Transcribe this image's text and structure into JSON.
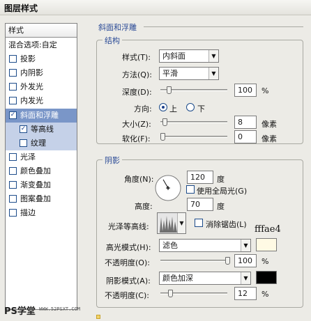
{
  "window": {
    "title": "图层样式"
  },
  "style_list": {
    "header": "样式",
    "items": [
      {
        "label": "混合选项:自定",
        "checkbox": false,
        "checked": false,
        "state": "normal",
        "indent": false
      },
      {
        "label": "投影",
        "checkbox": true,
        "checked": false,
        "state": "normal",
        "indent": false
      },
      {
        "label": "内阴影",
        "checkbox": true,
        "checked": false,
        "state": "normal",
        "indent": false
      },
      {
        "label": "外发光",
        "checkbox": true,
        "checked": false,
        "state": "normal",
        "indent": false
      },
      {
        "label": "内发光",
        "checkbox": true,
        "checked": false,
        "state": "normal",
        "indent": false
      },
      {
        "label": "斜面和浮雕",
        "checkbox": true,
        "checked": true,
        "state": "selected",
        "indent": false
      },
      {
        "label": "等高线",
        "checkbox": true,
        "checked": true,
        "state": "sub",
        "indent": true
      },
      {
        "label": "纹理",
        "checkbox": true,
        "checked": false,
        "state": "sub",
        "indent": true
      },
      {
        "label": "光泽",
        "checkbox": true,
        "checked": false,
        "state": "normal",
        "indent": false
      },
      {
        "label": "颜色叠加",
        "checkbox": true,
        "checked": false,
        "state": "normal",
        "indent": false
      },
      {
        "label": "渐变叠加",
        "checkbox": true,
        "checked": false,
        "state": "normal",
        "indent": false
      },
      {
        "label": "图案叠加",
        "checkbox": true,
        "checked": false,
        "state": "normal",
        "indent": false
      },
      {
        "label": "描边",
        "checkbox": true,
        "checked": false,
        "state": "normal",
        "indent": false
      }
    ]
  },
  "bevel": {
    "section_title": "斜面和浮雕",
    "structure": {
      "title": "结构",
      "style_label": "样式(T):",
      "style_value": "内斜面",
      "technique_label": "方法(Q):",
      "technique_value": "平滑",
      "depth_label": "深度(D):",
      "depth_value": "100",
      "depth_unit": "%",
      "depth_slider": 0.1,
      "direction_label": "方向:",
      "direction_up": "上",
      "direction_down": "下",
      "direction_selected": "up",
      "size_label": "大小(Z):",
      "size_value": "8",
      "size_unit": "像素",
      "size_slider": 0.03,
      "soften_label": "软化(F):",
      "soften_value": "0",
      "soften_unit": "像素",
      "soften_slider": 0.0
    },
    "shading": {
      "title": "阴影",
      "angle_label": "角度(N):",
      "angle_value": "120",
      "angle_unit": "度",
      "use_global_light": "使用全局光(G)",
      "use_global_light_checked": false,
      "altitude_label": "高度:",
      "altitude_value": "70",
      "altitude_unit": "度",
      "gloss_contour_label": "光泽等高线:",
      "anti_aliased": "消除锯齿(L)",
      "anti_aliased_checked": false,
      "highlight_mode_label": "高光模式(H):",
      "highlight_mode_value": "滤色",
      "highlight_color": "#fffae4",
      "highlight_color_annotation": "fffae4",
      "highlight_opacity_label": "不透明度(O):",
      "highlight_opacity_value": "100",
      "highlight_opacity_unit": "%",
      "highlight_opacity_slider": 1.0,
      "shadow_mode_label": "阴影模式(A):",
      "shadow_mode_value": "颜色加深",
      "shadow_color": "#000000",
      "shadow_opacity_label": "不透明度(C):",
      "shadow_opacity_value": "12",
      "shadow_opacity_unit": "%",
      "shadow_opacity_slider": 0.12
    }
  },
  "watermark": {
    "logo_text": "PS学堂",
    "url_text": "WWW.52PSXT.COM"
  },
  "colors": {
    "accent": "#2a4a96",
    "selected_row": "#7a96c8",
    "sub_row": "#c5d1e8"
  }
}
